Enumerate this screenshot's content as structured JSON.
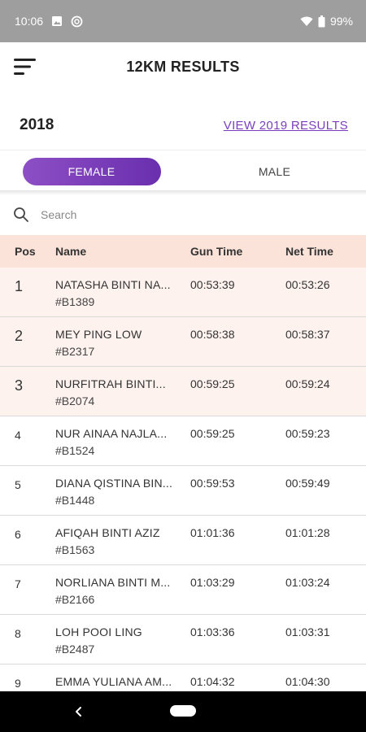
{
  "status_bar": {
    "time": "10:06",
    "battery": "99%"
  },
  "app_bar": {
    "title": "12KM RESULTS",
    "menu_icon": "menu-icon"
  },
  "year_row": {
    "year": "2018",
    "link": "VIEW 2019 RESULTS"
  },
  "tabs": [
    {
      "label": "FEMALE",
      "active": true
    },
    {
      "label": "MALE",
      "active": false
    }
  ],
  "search": {
    "placeholder": "Search",
    "value": ""
  },
  "table": {
    "headers": {
      "pos": "Pos",
      "name": "Name",
      "gun": "Gun Time",
      "net": "Net Time"
    },
    "rows": [
      {
        "pos": "1",
        "name": "NATASHA BINTI NA...",
        "bib": "#B1389",
        "gun": "00:53:39",
        "net": "00:53:26"
      },
      {
        "pos": "2",
        "name": "MEY PING LOW",
        "bib": "#B2317",
        "gun": "00:58:38",
        "net": "00:58:37"
      },
      {
        "pos": "3",
        "name": "NURFITRAH BINTI...",
        "bib": "#B2074",
        "gun": "00:59:25",
        "net": "00:59:24"
      },
      {
        "pos": "4",
        "name": "NUR AINAA NAJLA...",
        "bib": "#B1524",
        "gun": "00:59:25",
        "net": "00:59:23"
      },
      {
        "pos": "5",
        "name": "DIANA QISTINA BIN...",
        "bib": "#B1448",
        "gun": "00:59:53",
        "net": "00:59:49"
      },
      {
        "pos": "6",
        "name": "AFIQAH BINTI AZIZ",
        "bib": "#B1563",
        "gun": "01:01:36",
        "net": "01:01:28"
      },
      {
        "pos": "7",
        "name": "NORLIANA BINTI M...",
        "bib": "#B2166",
        "gun": "01:03:29",
        "net": "01:03:24"
      },
      {
        "pos": "8",
        "name": "LOH POOI LING",
        "bib": "#B2487",
        "gun": "01:03:36",
        "net": "01:03:31"
      },
      {
        "pos": "9",
        "name": "EMMA YULIANA AM...",
        "bib": "",
        "gun": "01:04:32",
        "net": "01:04:30"
      }
    ]
  },
  "colors": {
    "accent": "#7b3fbe",
    "header_bg": "#fbe3d9",
    "top3_bg": "#fdf2ee"
  }
}
